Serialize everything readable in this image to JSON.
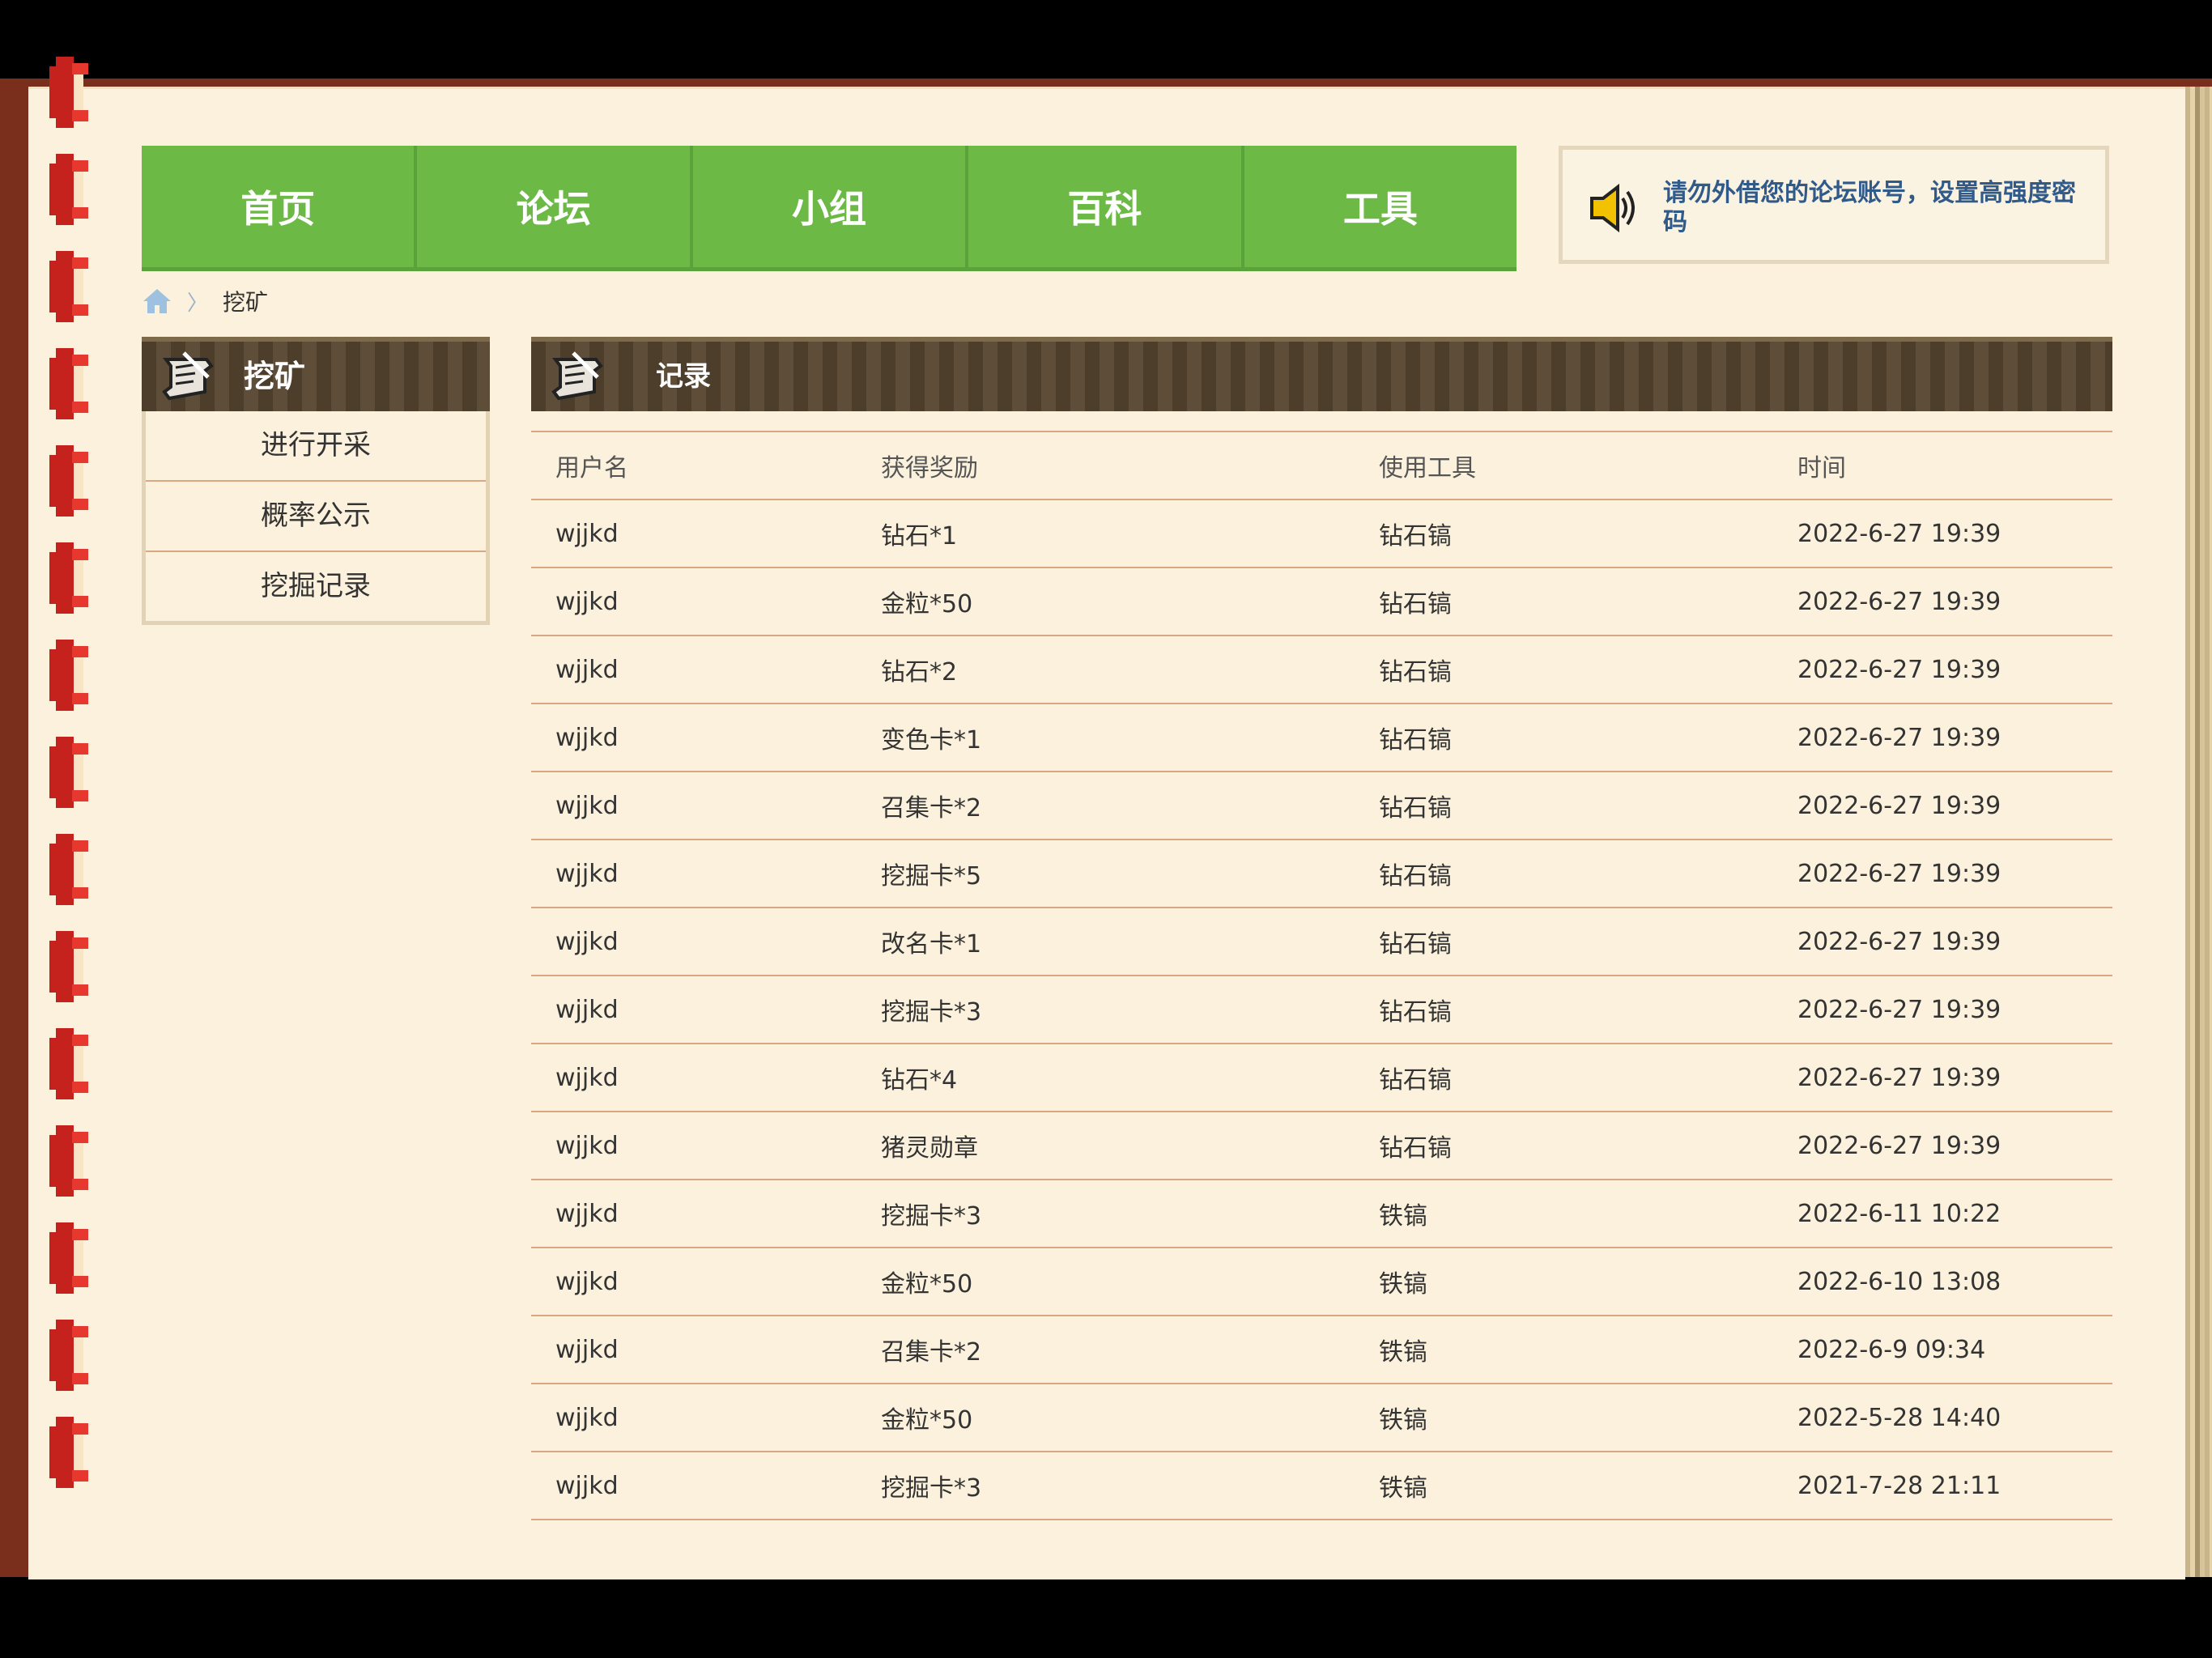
{
  "nav": {
    "items": [
      "首页",
      "论坛",
      "小组",
      "百科",
      "工具"
    ]
  },
  "notice": {
    "text": "请勿外借您的论坛账号，设置高强度密码",
    "icon": "speaker-icon"
  },
  "breadcrumb": {
    "current": "挖矿",
    "separator": "〉"
  },
  "sidebar": {
    "title": "挖矿",
    "items": [
      "进行开采",
      "概率公示",
      "挖掘记录"
    ]
  },
  "main": {
    "title": "记录",
    "columns": [
      "用户名",
      "获得奖励",
      "使用工具",
      "时间"
    ],
    "rows": [
      [
        "wjjkd",
        "钻石*1",
        "钻石镐",
        "2022-6-27 19:39"
      ],
      [
        "wjjkd",
        "金粒*50",
        "钻石镐",
        "2022-6-27 19:39"
      ],
      [
        "wjjkd",
        "钻石*2",
        "钻石镐",
        "2022-6-27 19:39"
      ],
      [
        "wjjkd",
        "变色卡*1",
        "钻石镐",
        "2022-6-27 19:39"
      ],
      [
        "wjjkd",
        "召集卡*2",
        "钻石镐",
        "2022-6-27 19:39"
      ],
      [
        "wjjkd",
        "挖掘卡*5",
        "钻石镐",
        "2022-6-27 19:39"
      ],
      [
        "wjjkd",
        "改名卡*1",
        "钻石镐",
        "2022-6-27 19:39"
      ],
      [
        "wjjkd",
        "挖掘卡*3",
        "钻石镐",
        "2022-6-27 19:39"
      ],
      [
        "wjjkd",
        "钻石*4",
        "钻石镐",
        "2022-6-27 19:39"
      ],
      [
        "wjjkd",
        "猪灵勋章",
        "钻石镐",
        "2022-6-27 19:39"
      ],
      [
        "wjjkd",
        "挖掘卡*3",
        "铁镐",
        "2022-6-11 10:22"
      ],
      [
        "wjjkd",
        "金粒*50",
        "铁镐",
        "2022-6-10 13:08"
      ],
      [
        "wjjkd",
        "召集卡*2",
        "铁镐",
        "2022-6-9 09:34"
      ],
      [
        "wjjkd",
        "金粒*50",
        "铁镐",
        "2022-5-28 14:40"
      ],
      [
        "wjjkd",
        "挖掘卡*3",
        "铁镐",
        "2021-7-28 21:11"
      ]
    ]
  },
  "colors": {
    "nav_green": "#6cb946",
    "paper": "#fbf1dc",
    "header_brown": "#574630",
    "divider": "#d7a882",
    "notice_text": "#2f5a8a"
  }
}
